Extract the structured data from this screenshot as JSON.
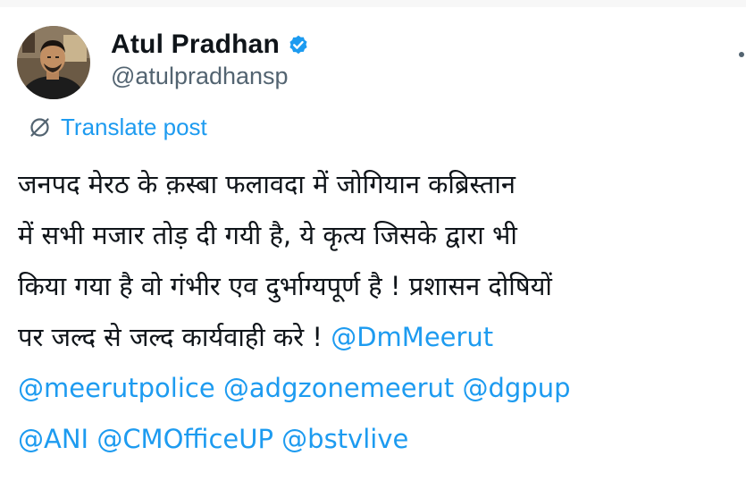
{
  "tweet": {
    "author": {
      "display_name": "Atul Pradhan",
      "handle": "@atulpradhansp",
      "verified": true,
      "avatar_icon": "profile-photo"
    },
    "translate_label": "Translate post",
    "translate_icon": "translate-globe-icon",
    "lines": [
      [
        "जनपद मेरठ के क़स्बा फलावदा में जोगियान कब्रिस्तान"
      ],
      [
        "में सभी मजार तोड़ दी गयी है, ये कृत्य जिसके द्वारा भी"
      ],
      [
        "किया गया है वो गंभीर एव दुर्भाग्यपूर्ण है ! प्रशासन दोषियों"
      ],
      [
        "पर जल्द से जल्द कार्यवाही करे ! ",
        "@DmMeerut"
      ],
      [
        "@meerutpolice",
        " ",
        "@adgzonemeerut",
        " ",
        "@dgpup"
      ],
      [
        "@ANI",
        " ",
        "@CMOfficeUP",
        " ",
        "@bstvlive"
      ]
    ]
  },
  "colors": {
    "text": "#0f1419",
    "secondary": "#536471",
    "accent": "#1d9bf0"
  }
}
